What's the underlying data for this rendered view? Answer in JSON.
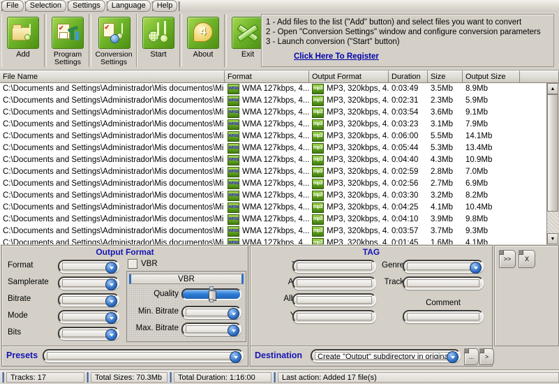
{
  "menu": {
    "items": [
      {
        "label": "File",
        "accel": "F"
      },
      {
        "label": "Selection",
        "accel": "S"
      },
      {
        "label": "Settings",
        "accel": "e"
      },
      {
        "label": "Language",
        "accel": "L"
      },
      {
        "label": "Help",
        "accel": "H"
      }
    ]
  },
  "toolbar": {
    "buttons": [
      {
        "label": "Add",
        "label2": "",
        "icon": "add-folder-music-icon"
      },
      {
        "label": "Program",
        "label2": "Settings",
        "icon": "program-settings-icon"
      },
      {
        "label": "Conversion",
        "label2": "Settings",
        "icon": "conversion-settings-icon"
      },
      {
        "label": "Start",
        "label2": "",
        "icon": "start-music-icon"
      },
      {
        "label": "About",
        "label2": "",
        "icon": "about-icon"
      },
      {
        "label": "Exit",
        "label2": "",
        "icon": "exit-icon"
      }
    ]
  },
  "instructions": {
    "lines": [
      "1 - Add files to the list (\"Add\" button) and select files you want to convert",
      "2 - Open \"Conversion Settings\" window and configure conversion parameters",
      "3 - Launch conversion (\"Start\" button)"
    ],
    "register_link": "Click Here To Register"
  },
  "filelist": {
    "columns": [
      "File Name",
      "Format",
      "Output Format",
      "Duration",
      "Size",
      "Output Size",
      ""
    ],
    "format_icon_label": "wma",
    "output_icon_label": "mp3",
    "rows": [
      {
        "name": "C:\\Documents and Settings\\Administrador\\Mis documentos\\Mi ...",
        "format": "WMA 127kbps, 4...",
        "output": "MP3, 320kbps, 4...",
        "duration": "0:03:49",
        "size": "3.5Mb",
        "outsize": "8.9Mb"
      },
      {
        "name": "C:\\Documents and Settings\\Administrador\\Mis documentos\\Mi ...",
        "format": "WMA 127kbps, 4...",
        "output": "MP3, 320kbps, 4...",
        "duration": "0:02:31",
        "size": "2.3Mb",
        "outsize": "5.9Mb"
      },
      {
        "name": "C:\\Documents and Settings\\Administrador\\Mis documentos\\Mi ...",
        "format": "WMA 127kbps, 4...",
        "output": "MP3, 320kbps, 4...",
        "duration": "0:03:54",
        "size": "3.6Mb",
        "outsize": "9.1Mb"
      },
      {
        "name": "C:\\Documents and Settings\\Administrador\\Mis documentos\\Mi ...",
        "format": "WMA 127kbps, 4...",
        "output": "MP3, 320kbps, 4...",
        "duration": "0:03:23",
        "size": "3.1Mb",
        "outsize": "7.9Mb"
      },
      {
        "name": "C:\\Documents and Settings\\Administrador\\Mis documentos\\Mi ...",
        "format": "WMA 127kbps, 4...",
        "output": "MP3, 320kbps, 4...",
        "duration": "0:06:00",
        "size": "5.5Mb",
        "outsize": "14.1Mb"
      },
      {
        "name": "C:\\Documents and Settings\\Administrador\\Mis documentos\\Mi ...",
        "format": "WMA 127kbps, 4...",
        "output": "MP3, 320kbps, 4...",
        "duration": "0:05:44",
        "size": "5.3Mb",
        "outsize": "13.4Mb"
      },
      {
        "name": "C:\\Documents and Settings\\Administrador\\Mis documentos\\Mi ...",
        "format": "WMA 127kbps, 4...",
        "output": "MP3, 320kbps, 4...",
        "duration": "0:04:40",
        "size": "4.3Mb",
        "outsize": "10.9Mb"
      },
      {
        "name": "C:\\Documents and Settings\\Administrador\\Mis documentos\\Mi ...",
        "format": "WMA 127kbps, 4...",
        "output": "MP3, 320kbps, 4...",
        "duration": "0:02:59",
        "size": "2.8Mb",
        "outsize": "7.0Mb"
      },
      {
        "name": "C:\\Documents and Settings\\Administrador\\Mis documentos\\Mi ...",
        "format": "WMA 127kbps, 4...",
        "output": "MP3, 320kbps, 4...",
        "duration": "0:02:56",
        "size": "2.7Mb",
        "outsize": "6.9Mb"
      },
      {
        "name": "C:\\Documents and Settings\\Administrador\\Mis documentos\\Mi ...",
        "format": "WMA 127kbps, 4...",
        "output": "MP3, 320kbps, 4...",
        "duration": "0:03:30",
        "size": "3.2Mb",
        "outsize": "8.2Mb"
      },
      {
        "name": "C:\\Documents and Settings\\Administrador\\Mis documentos\\Mi ...",
        "format": "WMA 127kbps, 4...",
        "output": "MP3, 320kbps, 4...",
        "duration": "0:04:25",
        "size": "4.1Mb",
        "outsize": "10.4Mb"
      },
      {
        "name": "C:\\Documents and Settings\\Administrador\\Mis documentos\\Mi ...",
        "format": "WMA 127kbps, 4...",
        "output": "MP3, 320kbps, 4...",
        "duration": "0:04:10",
        "size": "3.9Mb",
        "outsize": "9.8Mb"
      },
      {
        "name": "C:\\Documents and Settings\\Administrador\\Mis documentos\\Mi ...",
        "format": "WMA 127kbps, 4...",
        "output": "MP3, 320kbps, 4...",
        "duration": "0:03:57",
        "size": "3.7Mb",
        "outsize": "9.3Mb"
      },
      {
        "name": "C:\\Documents and Settings\\Administrador\\Mis documentos\\Mi ...",
        "format": "WMA 127kbps, 4...",
        "output": "MP3, 320kbps, 4...",
        "duration": "0:01:45",
        "size": "1.6Mb",
        "outsize": "4.1Mb"
      }
    ]
  },
  "output_format": {
    "title": "Output Format",
    "fields": [
      {
        "label": "Format",
        "value": ""
      },
      {
        "label": "Samplerate",
        "value": ""
      },
      {
        "label": "Bitrate",
        "value": ""
      },
      {
        "label": "Mode",
        "value": ""
      },
      {
        "label": "Bits",
        "value": ""
      }
    ],
    "vbr_checkbox_label": "VBR",
    "vbr_group_title": "VBR",
    "quality_label": "Quality",
    "min_bitrate_label": "Min. Bitrate",
    "min_bitrate_value": "",
    "max_bitrate_label": "Max. Bitrate",
    "max_bitrate_value": "",
    "presets_label": "Presets",
    "presets_value": ""
  },
  "tag": {
    "title": "TAG",
    "left_fields": [
      {
        "label": "Title",
        "value": ""
      },
      {
        "label": "Artist",
        "value": ""
      },
      {
        "label": "Album",
        "value": ""
      },
      {
        "label": "Year",
        "value": ""
      }
    ],
    "genre_label": "Genre",
    "genre_value": "",
    "track_label": "Track",
    "track_value": "",
    "comment_label": "Comment",
    "comment_value": ""
  },
  "destination": {
    "label": "Destination",
    "value": "Create \"Output\" subdirectory in origina",
    "browse_button": "...",
    "go_button": ">"
  },
  "side_buttons": [
    {
      "glyph": ">>",
      "name": "move-right-button"
    },
    {
      "glyph": "X",
      "name": "clear-button"
    }
  ],
  "statusbar": {
    "tracks": "Tracks: 17",
    "total_sizes": "Total Sizes: 70.3Mb",
    "total_duration": "Total Duration: 1:16:00",
    "last_action": "Last action: Added 17 file(s)"
  },
  "colors": {
    "accent_blue": "#1616b4",
    "link_blue": "#0000aa",
    "face": "#d4d0c8",
    "green": "#6fb52a"
  }
}
